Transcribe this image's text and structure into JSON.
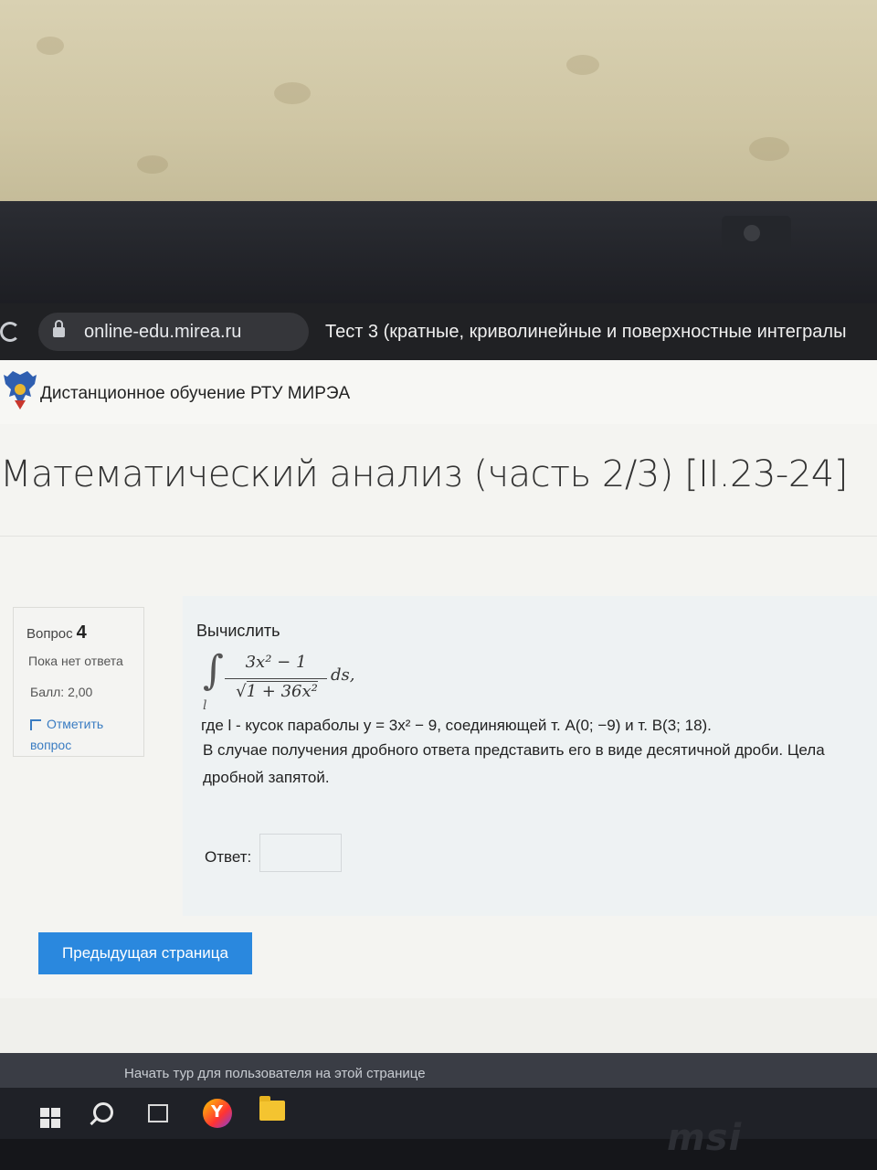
{
  "browser": {
    "url": "online-edu.mirea.ru",
    "tab_title": "Тест 3 (кратные, криволинейные и поверхностные интегралы"
  },
  "site": {
    "name": "Дистанционное обучение РТУ МИРЭА",
    "course_title": "Математический анализ (часть 2/3) [II.23-24]"
  },
  "question_info": {
    "label": "Вопрос",
    "number": "4",
    "status": "Пока нет ответа",
    "grade": "Балл: 2,00",
    "flag_label": "Отметить вопрос"
  },
  "question": {
    "prompt": "Вычислить",
    "integral": {
      "numerator": "3x² − 1",
      "radicand": "1 + 36x²",
      "differential": "ds,",
      "contour": "l"
    },
    "where_text": "где l - кусок параболы y = 3x² − 9, соединяющей т. A(0; −9) и т. B(3; 18).",
    "instruction_line1": "В случае получения дробного ответа представить его в виде десятичной дроби. Цела",
    "instruction_line2": "дробной запятой.",
    "answer_label": "Ответ:",
    "answer_value": ""
  },
  "navigation": {
    "prev_button": "Предыдущая страница"
  },
  "footer": {
    "tour_link": "Начать тур для пользователя на этой странице"
  },
  "laptop": {
    "brand": "msi"
  },
  "colors": {
    "accent_button": "#2a88de",
    "link": "#3a7cc2",
    "address_bar": "#202124"
  }
}
